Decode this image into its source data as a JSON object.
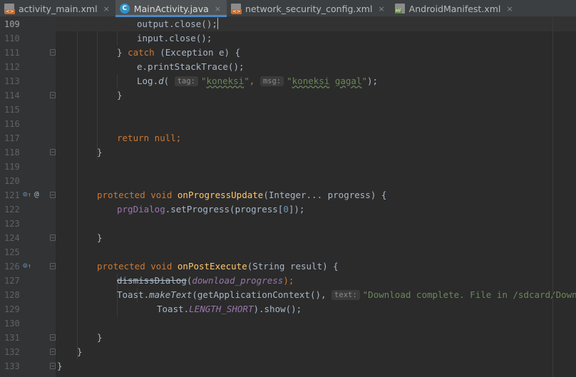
{
  "tabs": [
    {
      "label": "activity_main.xml",
      "icon": "xml-file-icon",
      "active": false
    },
    {
      "label": "MainActivity.java",
      "icon": "java-class-icon",
      "active": true
    },
    {
      "label": "network_security_config.xml",
      "icon": "xml-file-icon",
      "active": false
    },
    {
      "label": "AndroidManifest.xml",
      "icon": "manifest-file-icon",
      "active": false
    }
  ],
  "tab_close_glyph": "×",
  "class_icon_letter": "C",
  "current_line": 109,
  "gutter_marks": {
    "override_glyph": "⊙",
    "up_arrow_glyph": "↑",
    "annotation_glyph": "@"
  },
  "lines": [
    {
      "n": 109,
      "tokens": [
        {
          "t": "output.close();",
          "c": "plain"
        }
      ]
    },
    {
      "n": 110,
      "tokens": [
        {
          "t": "input.close();",
          "c": "plain"
        }
      ]
    },
    {
      "n": 111,
      "tokens": [
        {
          "t": "} ",
          "c": "plain"
        },
        {
          "t": "catch",
          "c": "kw"
        },
        {
          "t": " (Exception e) {",
          "c": "plain"
        }
      ]
    },
    {
      "n": 112,
      "tokens": [
        {
          "t": "e.printStackTrace();",
          "c": "plain"
        }
      ]
    },
    {
      "n": 113,
      "tokens": [
        {
          "t": "Log.",
          "c": "plain"
        },
        {
          "t": "d",
          "c": "ital"
        },
        {
          "t": "( ",
          "c": "plain"
        },
        {
          "t": "tag:",
          "c": "hint"
        },
        {
          "t": "\"koneksi\"",
          "c": "str"
        },
        {
          "t": ", ",
          "c": "kw"
        },
        {
          "t": "msg:",
          "c": "hint"
        },
        {
          "t": "\"koneksi gagal\"",
          "c": "str"
        },
        {
          "t": ");",
          "c": "plain"
        }
      ]
    },
    {
      "n": 114,
      "tokens": [
        {
          "t": "}",
          "c": "plain"
        }
      ]
    },
    {
      "n": 115,
      "tokens": []
    },
    {
      "n": 116,
      "tokens": []
    },
    {
      "n": 117,
      "tokens": [
        {
          "t": "return null",
          "c": "kw"
        },
        {
          "t": ";",
          "c": "kw"
        }
      ]
    },
    {
      "n": 118,
      "tokens": [
        {
          "t": "}",
          "c": "plain"
        }
      ]
    },
    {
      "n": 119,
      "tokens": []
    },
    {
      "n": 120,
      "tokens": []
    },
    {
      "n": 121,
      "tokens": [
        {
          "t": "protected void ",
          "c": "kw"
        },
        {
          "t": "onProgressUpdate",
          "c": "fn"
        },
        {
          "t": "(Integer... progress) {",
          "c": "plain"
        }
      ]
    },
    {
      "n": 122,
      "tokens": [
        {
          "t": "prgDialog",
          "c": "fld"
        },
        {
          "t": ".setProgress(progress[",
          "c": "plain"
        },
        {
          "t": "0",
          "c": "num"
        },
        {
          "t": "]);",
          "c": "plain"
        }
      ]
    },
    {
      "n": 123,
      "tokens": []
    },
    {
      "n": 124,
      "tokens": [
        {
          "t": "}",
          "c": "plain"
        }
      ]
    },
    {
      "n": 125,
      "tokens": []
    },
    {
      "n": 126,
      "tokens": [
        {
          "t": "protected void ",
          "c": "kw"
        },
        {
          "t": "onPostExecute",
          "c": "fn"
        },
        {
          "t": "(String result) {",
          "c": "plain"
        }
      ]
    },
    {
      "n": 127,
      "tokens": [
        {
          "t": "dismissDialog",
          "c": "depr"
        },
        {
          "t": "(",
          "c": "plain"
        },
        {
          "t": "download_progress",
          "c": "sfld"
        },
        {
          "t": ");",
          "c": "kw"
        }
      ]
    },
    {
      "n": 128,
      "tokens": [
        {
          "t": "Toast.",
          "c": "plain"
        },
        {
          "t": "makeText",
          "c": "ital"
        },
        {
          "t": "(getApplicationContext(), ",
          "c": "plain"
        },
        {
          "t": "text:",
          "c": "hint"
        },
        {
          "t": "\"Download complete. File in /sdcard/Download\",",
          "c": "str"
        }
      ]
    },
    {
      "n": 129,
      "tokens": [
        {
          "t": "Toast.",
          "c": "plain"
        },
        {
          "t": "LENGTH_SHORT",
          "c": "sfld"
        },
        {
          "t": ").show();",
          "c": "plain"
        }
      ]
    },
    {
      "n": 130,
      "tokens": []
    },
    {
      "n": 131,
      "tokens": [
        {
          "t": "}",
          "c": "plain"
        }
      ]
    },
    {
      "n": 132,
      "tokens": [
        {
          "t": "}",
          "c": "plain"
        }
      ]
    },
    {
      "n": 133,
      "tokens": [
        {
          "t": "}",
          "c": "plain"
        }
      ]
    }
  ]
}
